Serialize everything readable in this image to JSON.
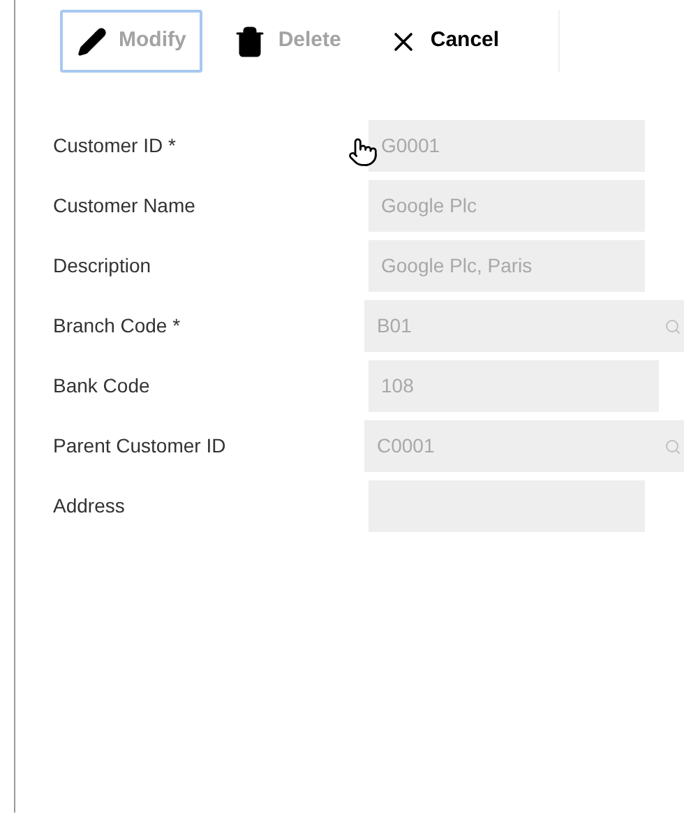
{
  "toolbar": [
    {
      "kind": "modify",
      "label": "Modify",
      "focused": true,
      "disabled": true
    },
    {
      "kind": "delete",
      "label": "Delete",
      "focused": false,
      "disabled": true
    },
    {
      "kind": "cancel",
      "label": "Cancel",
      "focused": false,
      "disabled": false
    }
  ],
  "fields": [
    {
      "label": "Customer ID *",
      "value": "G0001",
      "kind": "text",
      "disabled": true
    },
    {
      "label": "Customer Name",
      "value": "Google Plc",
      "kind": "text",
      "disabled": true
    },
    {
      "label": "Description",
      "value": "Google Plc, Paris",
      "kind": "text",
      "disabled": true
    },
    {
      "label": "Branch Code *",
      "value": "B01",
      "kind": "lookup",
      "disabled": true
    },
    {
      "label": "Bank Code",
      "value": "108",
      "kind": "wide",
      "disabled": true
    },
    {
      "label": "Parent Customer ID",
      "value": "C0001",
      "kind": "lookup",
      "disabled": true
    },
    {
      "label": "Address",
      "kind": "text",
      "disabled": true
    }
  ]
}
